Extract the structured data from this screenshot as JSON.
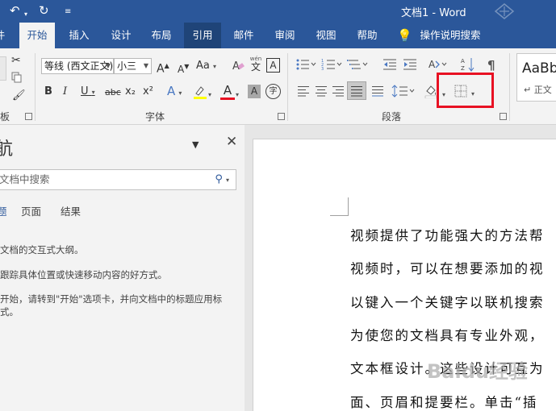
{
  "title_bar": {
    "doc_title": "文档1  -  Word"
  },
  "tabs": [
    {
      "label": "开始"
    },
    {
      "label": "插入"
    },
    {
      "label": "设计"
    },
    {
      "label": "布局"
    },
    {
      "label": "引用"
    },
    {
      "label": "邮件"
    },
    {
      "label": "审阅"
    },
    {
      "label": "视图"
    },
    {
      "label": "帮助"
    },
    {
      "label": "操作说明搜索"
    }
  ],
  "ribbon": {
    "font_name": "等线 (西文正文)",
    "font_size": "小三",
    "clipboard_label": "板",
    "font_group_label": "字体",
    "paragraph_group_label": "段落",
    "styles_preview": "AaBb",
    "styles_sub": "正文",
    "wen_glyph": "wén",
    "wen_char": "文",
    "a_boxed": "A",
    "big_a": "A",
    "small_a": "A",
    "aa": "Aa",
    "bold": "B",
    "italic": "I",
    "underline": "U",
    "strike": "abc",
    "sub": "x₂",
    "sup": "x²",
    "font_color_a": "A",
    "char_shade_a": "A",
    "enclose_char": "字",
    "highlight_color": "#ffff00",
    "font_color": "#e81123",
    "accent": "#2b579a"
  },
  "nav_pane": {
    "title": "航",
    "search_placeholder": "文档中搜索",
    "tabs": [
      "题",
      "页面",
      "结果"
    ],
    "lines": [
      "文档的交互式大纲。",
      "跟踪具体位置或快速移动内容的好方式。",
      "开始，请转到\"开始\"选项卡，并向文档中的标题应用标",
      "式。"
    ]
  },
  "document": {
    "lines": [
      "视频提供了功能强大的方法帮",
      "视频时，可以在想要添加的视",
      "以键入一个关键字以联机搜索",
      "为使您的文档具有专业外观，",
      "文本框设计。这些设计可互为",
      "面、页眉和提要栏。单击“插"
    ],
    "watermark": "Baidu经验"
  }
}
